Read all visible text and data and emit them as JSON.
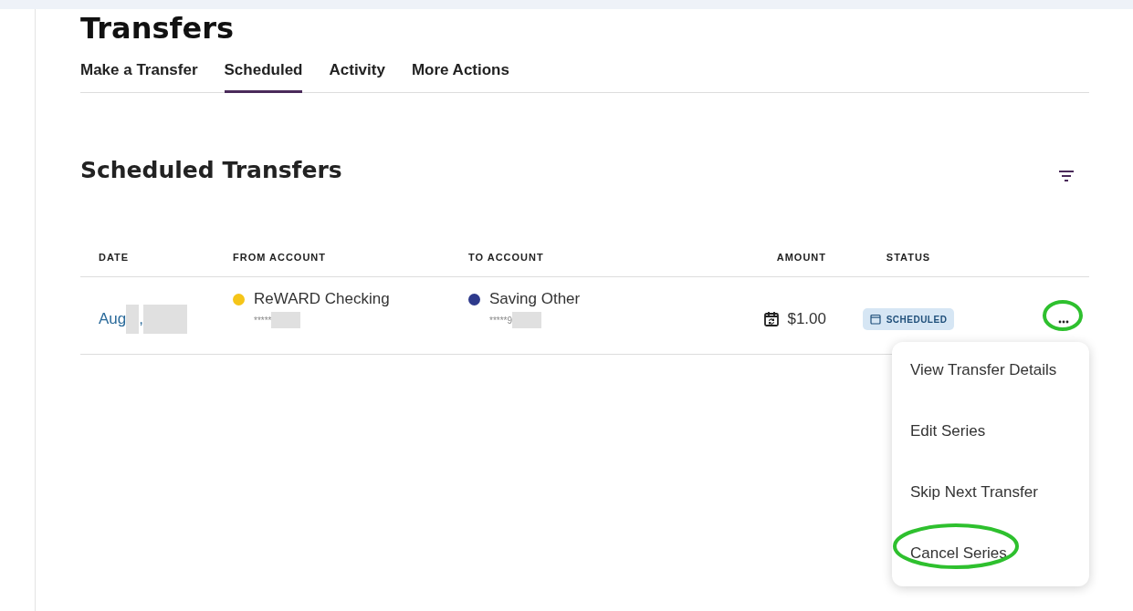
{
  "page_title": "Transfers",
  "tabs": [
    {
      "label": "Make a Transfer",
      "selected": false
    },
    {
      "label": "Scheduled",
      "selected": true
    },
    {
      "label": "Activity",
      "selected": false
    },
    {
      "label": "More Actions",
      "selected": false
    }
  ],
  "section_title": "Scheduled Transfers",
  "table": {
    "columns": [
      "DATE",
      "FROM ACCOUNT",
      "TO ACCOUNT",
      "AMOUNT",
      "STATUS"
    ],
    "rows": [
      {
        "date": "Aug",
        "date_separator": ",",
        "from": {
          "name": "ReWARD Checking",
          "mask": "*****",
          "color": "#f5c518"
        },
        "to": {
          "name": "Saving Other",
          "mask": "*****9",
          "color": "#2e3a8c"
        },
        "amount": "$1.00",
        "status": "SCHEDULED",
        "menu_highlighted": true
      }
    ]
  },
  "menu": {
    "items": [
      {
        "label": "View Transfer Details",
        "highlighted": false
      },
      {
        "label": "Edit Series",
        "highlighted": false
      },
      {
        "label": "Skip Next Transfer",
        "highlighted": false
      },
      {
        "label": "Cancel Series",
        "highlighted": true
      }
    ]
  }
}
